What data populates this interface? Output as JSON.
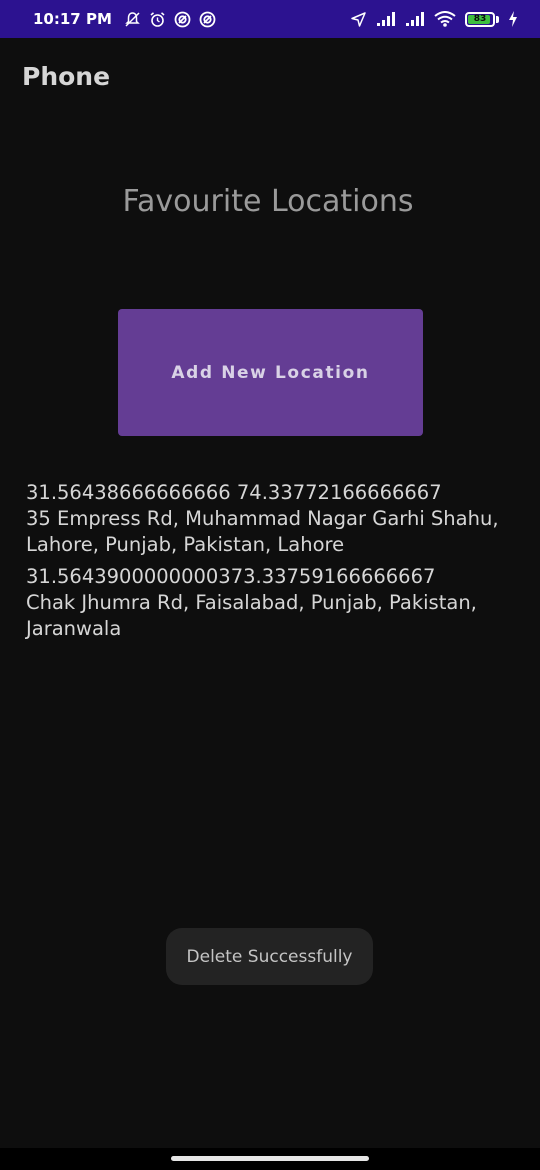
{
  "status_bar": {
    "time": "10:17 PM",
    "left_icons": [
      "no-notification-icon",
      "alarm-icon",
      "vpn-icon",
      "vpn-icon"
    ],
    "right_icons": [
      "location-arrow-icon",
      "signal-icon",
      "signal-icon",
      "wifi-icon"
    ],
    "battery_level": "83",
    "battery_percent": 0.83,
    "colors": {
      "background": "#2c1290",
      "battery_fill": "#3fbf3f"
    }
  },
  "app_bar": {
    "title": "Phone"
  },
  "main": {
    "heading": "Favourite Locations",
    "add_button_label": "Add New Location",
    "colors": {
      "button": "#643d94",
      "background": "#0e0e0e"
    },
    "locations": [
      {
        "coords": "31.56438666666666 74.33772166666667",
        "address_line1": "35 Empress Rd, Muhammad Nagar Garhi Shahu,",
        "address_line2": "Lahore, Punjab, Pakistan,  Lahore"
      },
      {
        "coords": "31.5643900000000373.33759166666667",
        "address_line1": "Chak Jhumra Rd, Faisalabad, Punjab, Pakistan,",
        "address_line2": "Jaranwala"
      }
    ]
  },
  "toast": {
    "message": "Delete Successfully"
  }
}
